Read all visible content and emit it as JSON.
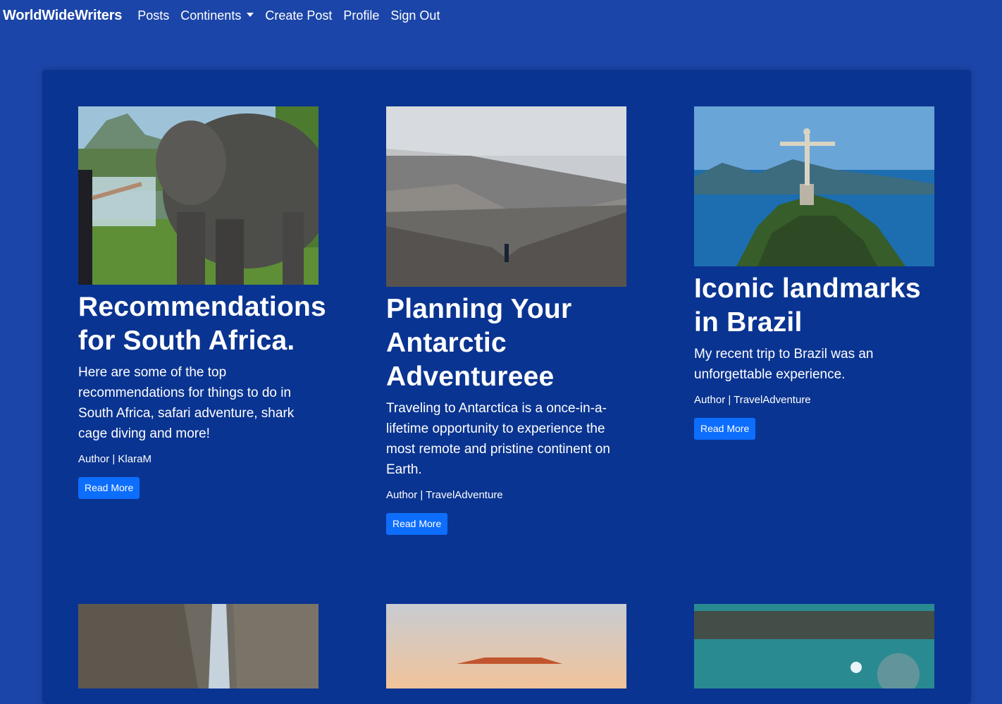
{
  "navbar": {
    "brand": "WorldWideWriters",
    "links": [
      "Posts",
      "Continents",
      "Create Post",
      "Profile",
      "Sign Out"
    ]
  },
  "posts": [
    {
      "title": "Recommendations for South Africa.",
      "text": "Here are some of the top recommendations for things to do in South Africa, safari adventure, shark cage diving and more!",
      "author": "Author | KlaraM",
      "button": "Read More",
      "image": "elephant-photo"
    },
    {
      "title": "Planning Your Antarctic Adventureee",
      "text": "Traveling to Antarctica is a once-in-a-lifetime opportunity to experience the most remote and pristine continent on Earth.",
      "author": "Author | TravelAdventure",
      "button": "Read More",
      "image": "mountain-hiker-photo"
    },
    {
      "title": "Iconic landmarks in Brazil",
      "text": "My recent trip to Brazil was an unforgettable experience.",
      "author": "Author | TravelAdventure",
      "button": "Read More",
      "image": "christ-the-redeemer-photo"
    }
  ],
  "lower_images": [
    "canyon-photo",
    "sunset-rock-photo",
    "underwater-photo"
  ],
  "colors": {
    "page_bg": "#1b45a8",
    "panel_bg": "#0a3491",
    "button_bg": "#0d6efd"
  }
}
